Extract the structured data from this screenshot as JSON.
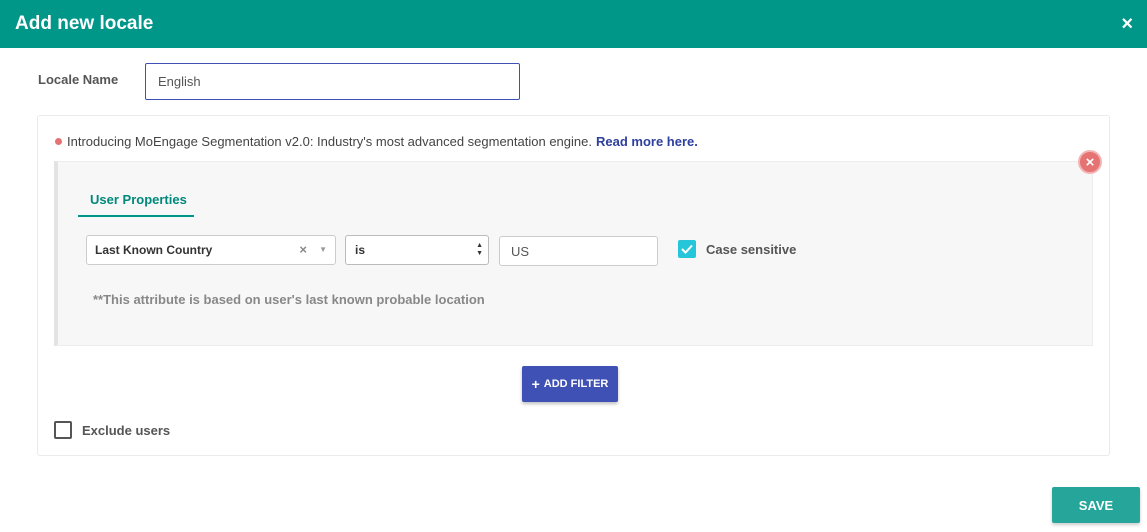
{
  "header": {
    "title": "Add new locale",
    "close_icon": "×"
  },
  "locale": {
    "label": "Locale Name",
    "value": "English"
  },
  "intro": {
    "text": "Introducing MoEngage Segmentation v2.0: Industry's most advanced segmentation engine.",
    "link": "Read more here."
  },
  "filter": {
    "remove_icon": "×",
    "tab": "User Properties",
    "attribute": "Last Known Country",
    "attribute_clear": "×",
    "attribute_caret": "▼",
    "operator": "is",
    "value": "US",
    "case_sensitive_label": "Case sensitive",
    "case_sensitive_checked": true,
    "note": "**This attribute is based on user's last known probable location"
  },
  "add_filter": {
    "icon": "+",
    "label": "ADD FILTER"
  },
  "exclude": {
    "label": "Exclude users",
    "checked": false
  },
  "save": {
    "label": "SAVE"
  },
  "colors": {
    "header": "#009688",
    "primary": "#3f51b5",
    "save": "#26a69a",
    "checkbox": "#26c6da",
    "danger": "#e57373"
  }
}
